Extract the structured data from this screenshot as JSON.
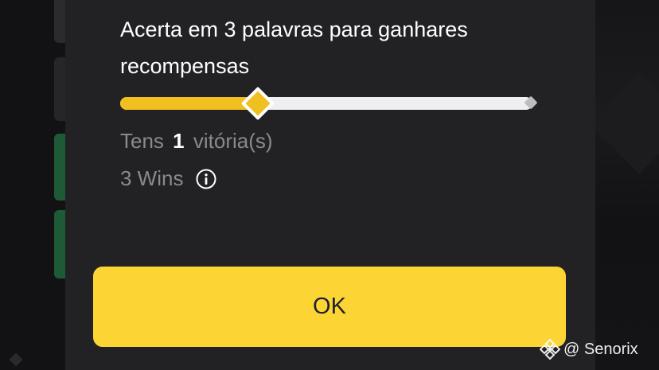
{
  "dialog": {
    "message": "Acerta em 3 palavras para ganhares recompensas",
    "progress": {
      "current_wins": 1,
      "required_wins": 3,
      "fraction": 0.33
    },
    "wins_prefix": "Tens",
    "wins_count": "1",
    "wins_suffix": "vitória(s)",
    "target_label": "3 Wins",
    "ok_label": "OK"
  },
  "watermark": {
    "handle": "@ Senorix",
    "logo_icon": "binance-logo"
  },
  "colors": {
    "accent": "#fcd535",
    "progress_fill": "#f0c020",
    "sheet_bg": "#222224",
    "muted_text": "#8a8a8d"
  }
}
